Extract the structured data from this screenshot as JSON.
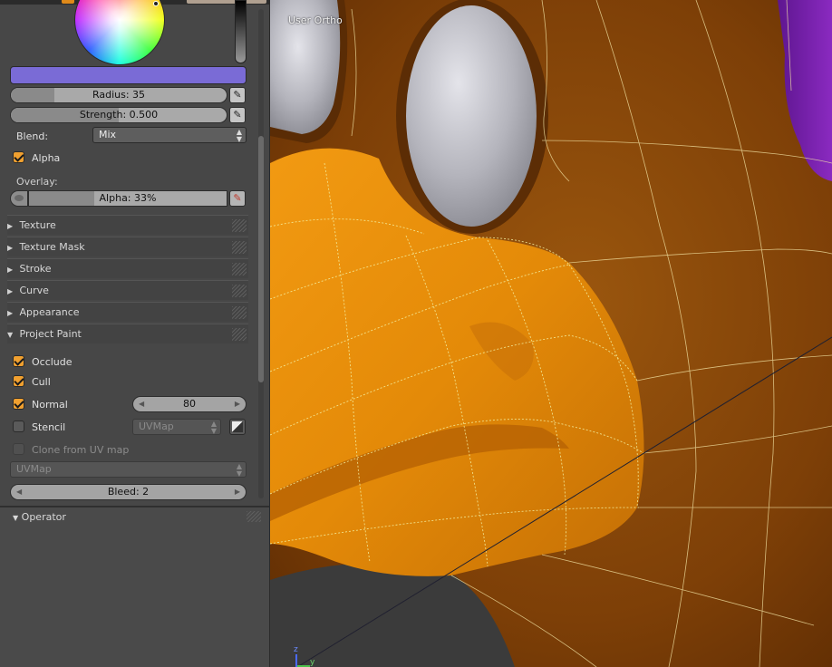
{
  "panel": {
    "radius_label": "Radius: 35",
    "strength_label": "Strength: 0.500",
    "radius_fraction": 0.2,
    "strength_fraction": 0.5,
    "blend_label": "Blend:",
    "blend_value": "Mix",
    "alpha_checkbox_label": "Alpha",
    "alpha_checked": true,
    "overlay_label": "Overlay:",
    "overlay_alpha_label": "Alpha: 33%",
    "overlay_alpha_fraction": 0.33,
    "brush_color": "#7a6bd6",
    "sections": {
      "texture": "Texture",
      "texture_mask": "Texture Mask",
      "stroke": "Stroke",
      "curve": "Curve",
      "appearance": "Appearance",
      "project_paint": "Project Paint"
    },
    "project_paint": {
      "occlude_label": "Occlude",
      "cull_label": "Cull",
      "normal_label": "Normal",
      "normal_value": "80",
      "stencil_label": "Stencil",
      "stencil_uvmap": "UVMap",
      "clone_label": "Clone from UV map",
      "clone_uvmap": "UVMap",
      "bleed_label": "Bleed: 2"
    },
    "operator_label": "Operator"
  },
  "viewport": {
    "view_label": "User Ortho",
    "axis_labels": {
      "z": "z",
      "y": "y"
    },
    "colors": {
      "mesh_selected": "#e8920a",
      "mesh_unselected": "#8a4a0c",
      "eyes": "#b8b8c0",
      "purple_region": "#7a20b0",
      "wire": "#f4f0a0"
    }
  },
  "icons": {
    "pen_icon": "✎",
    "brush_icon": "🖌",
    "triangle_right": "▶",
    "triangle_down": "▼",
    "arrow_left": "◀",
    "arrow_right": "▶",
    "updown": "▲▼"
  }
}
